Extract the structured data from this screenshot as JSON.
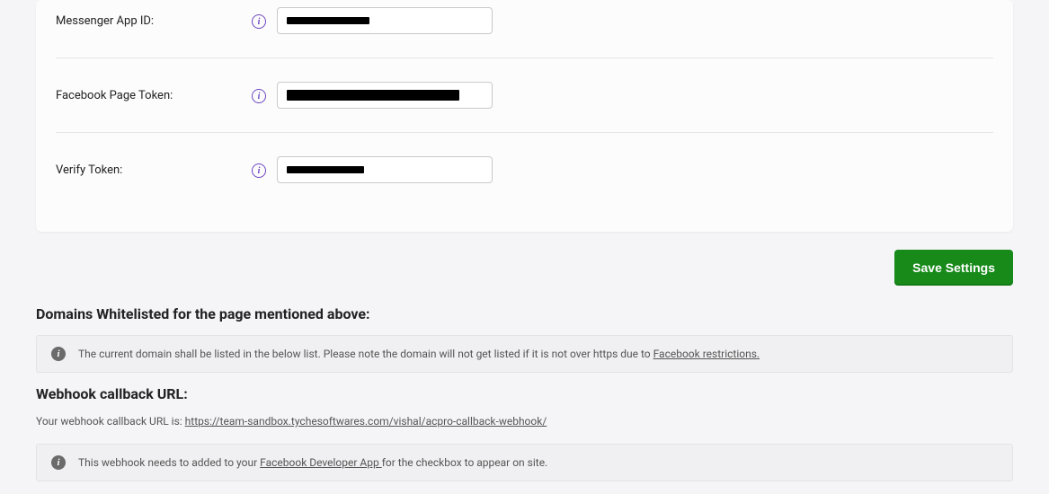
{
  "form": {
    "messenger_label": "Messenger App ID:",
    "page_token_label": "Facebook Page Token:",
    "verify_token_label": "Verify Token:"
  },
  "save_button": "Save Settings",
  "domains_heading": "Domains Whitelisted for the page mentioned above:",
  "domains_notice_pre": "The current domain shall be listed in the below list. Please note the domain will not get listed if it is not over https due to ",
  "domains_notice_link": "Facebook restrictions.",
  "webhook_heading": "Webhook callback URL:",
  "webhook_pre": "Your webhook callback URL is: ",
  "webhook_url": "https://team-sandbox.tychesoftwares.com/vishal/acpro-callback-webhook/",
  "webhook_notice_pre": "This webhook needs to added to your ",
  "webhook_notice_link": "Facebook Developer App ",
  "webhook_notice_post": "for the checkbox to appear on site."
}
